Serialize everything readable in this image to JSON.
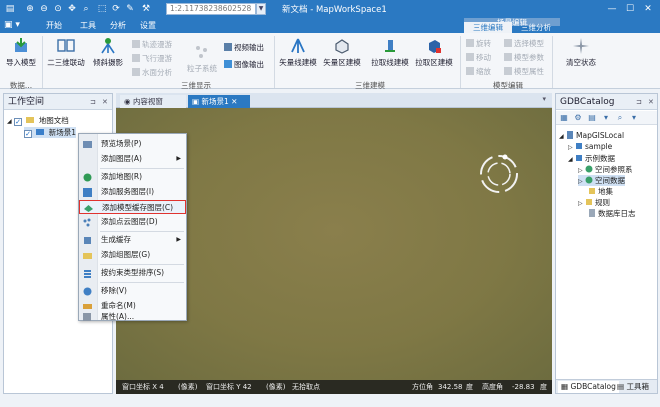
{
  "window": {
    "title": "新文档 - MapWorkSpace1",
    "coord_display": "1:2.11738238602528"
  },
  "menu": {
    "items": [
      "开始",
      "工具",
      "分析",
      "设置"
    ],
    "context_group": "场景编辑",
    "context_tabs": [
      "三维编辑",
      "三维分析"
    ]
  },
  "ribbon": {
    "import_model": "导入模型",
    "g_data": "数据...",
    "linkage_2d3d": "二三维联动",
    "oblique": "倾斜摄影",
    "track_roam": "轨迹漫游",
    "fly_roam": "飞行漫游",
    "water_analysis": "水面分析",
    "particle": "粒子系统",
    "video_out": "视频输出",
    "image_out": "图像输出",
    "g_3d_display": "三维显示",
    "vector_line": "矢量线建模",
    "vector_area": "矢量区建模",
    "extrude_line": "拉取线建模",
    "extrude_area": "拉取区建模",
    "g_3d_model": "三维建模",
    "rotate": "旋转",
    "move": "移动",
    "scale": "缩放",
    "select_model": "选择模型",
    "model_param": "模型参数",
    "model_attr": "模型属性",
    "g_model_edit": "模型编辑",
    "clear_state": "清空状态"
  },
  "left_pane": {
    "title": "工作空间",
    "tree": {
      "root": "地图文档",
      "scene": "新场景1"
    }
  },
  "doc_tabs": {
    "content_view": "内容视窗",
    "scene1": "新场景1"
  },
  "context_menu": {
    "items": [
      "预览场景(P)",
      "添加图层(A)",
      "添加地图(R)",
      "添加服务图层(I)",
      "添加模型缓存图层(C)",
      "添加点云图层(D)",
      "生成缓存",
      "添加组图层(G)",
      "按约束类型排序(S)",
      "移除(V)",
      "重命名(M)",
      "属性(A)..."
    ]
  },
  "status_bar": {
    "window_x": "窗口坐标 X 4",
    "unit1": "(像素)",
    "window_y": "窗口坐标 Y 42",
    "unit2": "(像素)",
    "no_point": "无拾取点",
    "azimuth_label": "方位角",
    "azimuth_value": "342.58",
    "azimuth_unit": "度",
    "elev_label": "高度角",
    "elev_value": "-28.83",
    "elev_unit": "度"
  },
  "right_pane": {
    "title": "GDBCatalog",
    "tree": {
      "root": "MapGISLocal",
      "sample": "sample",
      "example": "示例数据",
      "spatial_ref": "空间参照系",
      "spatial_data": "空间数据",
      "map_set": "地集",
      "rules": "规则",
      "db_log": "数据库日志"
    },
    "bottom_tabs": [
      "GDBCatalog",
      "工具箱"
    ]
  },
  "colors": {
    "accent": "#2b79c2",
    "highlight_border": "#e0332f",
    "viewport_fill": "#857c48"
  }
}
